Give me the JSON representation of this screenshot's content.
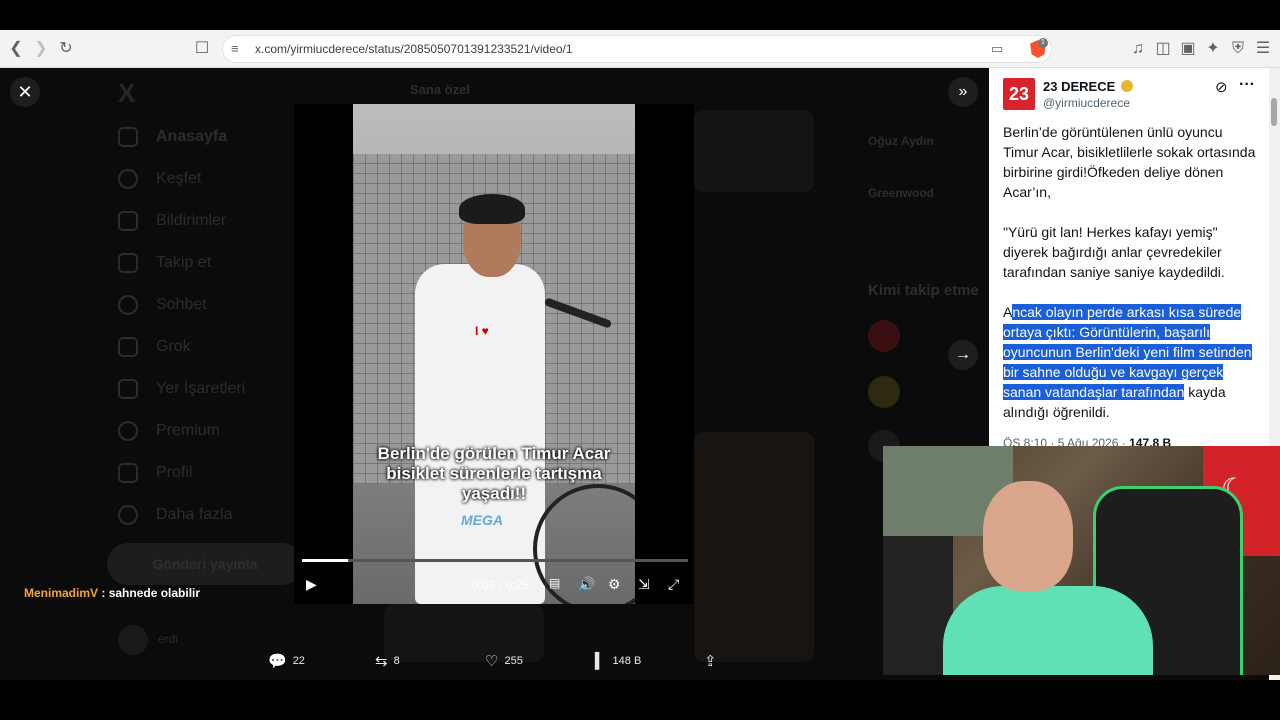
{
  "browser": {
    "url": "x.com/yirmiucderece/status/2085050701391233521/video/1",
    "brave_badge": "1"
  },
  "sidebar": {
    "items": [
      {
        "label": "Anasayfa"
      },
      {
        "label": "Keşfet"
      },
      {
        "label": "Bildirimler"
      },
      {
        "label": "Takip et"
      },
      {
        "label": "Sohbet"
      },
      {
        "label": "Grok"
      },
      {
        "label": "Yer İşaretleri"
      },
      {
        "label": "Premium"
      },
      {
        "label": "Profil"
      },
      {
        "label": "Daha fazla"
      }
    ],
    "post_button": "Gönderi yayınla",
    "user_name": "erdi"
  },
  "center_tabs": {
    "tab1": "Sana özel"
  },
  "video": {
    "caption_line1": "Berlin'de görülen Timur Acar",
    "caption_line2": "bisiklet sürenlerle tartışma",
    "caption_line3": "yaşadı!!",
    "watermark": "MEGA",
    "time": "0:03 / 0:25",
    "progress_fraction": 0.12
  },
  "chat": {
    "user": "MenimadimV",
    "message": ": sahnede olabilir"
  },
  "actions": {
    "replies": "22",
    "reposts": "8",
    "likes": "255",
    "views": "148 B"
  },
  "tweet": {
    "display_name": "23 DERECE",
    "handle": "@yirmiucderece",
    "avatar_text": "23",
    "para1": "Berlin’de görüntülenen ünlü oyuncu Timur Acar, bisikletlilerle sokak ortasında birbirine girdi!Öfkeden deliye dönen Acar’ın,",
    "para2": "\"Yürü git lan! Herkes kafayı yemiş\" diyerek bağırdığı anlar çevredekiler tarafından saniye saniye kaydedildi.",
    "para3_start": "A",
    "para3_selected": "ncak olayın perde arkası kısa sürede ortaya çıktı: Görüntülerin, başarılı oyuncunun Berlin'deki yeni film setinden bir sahne olduğu ve kavgayı gerçek sanan vatandaşlar tarafından",
    "para3_end": " kayda alındığı öğrenildi.",
    "timestamp": "ÖS 8:10 · 5 Ağu 2026 · ",
    "views": "147,8 B"
  },
  "right_dim": {
    "who_to_follow": "Kimi takip etme",
    "name1": "Oğuz Aydın",
    "name2": "Greenwood"
  },
  "colors": {
    "selection": "#1a5ed8",
    "chat_name": "#f0a53b",
    "cam_shirt": "#5fe1b5"
  }
}
